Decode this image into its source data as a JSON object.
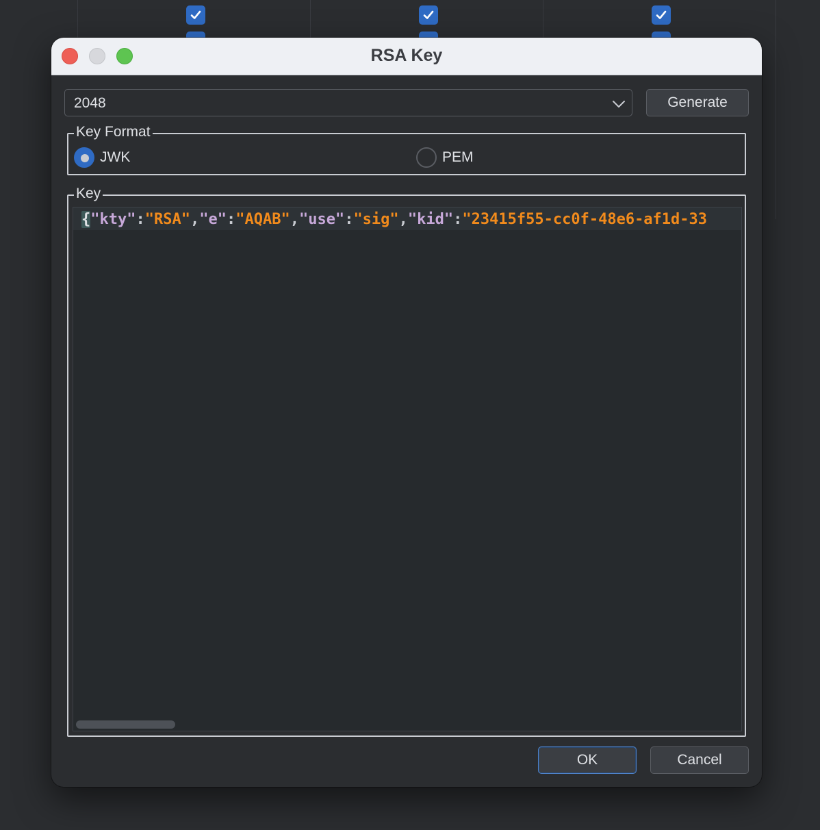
{
  "dialog": {
    "title": "RSA Key"
  },
  "key_size": {
    "selected": "2048"
  },
  "generate_label": "Generate",
  "key_format": {
    "legend": "Key Format",
    "options": [
      {
        "label": "JWK",
        "selected": true
      },
      {
        "label": "PEM",
        "selected": false
      }
    ]
  },
  "key": {
    "legend": "Key",
    "tokens": {
      "open_brace": "{",
      "q1": "\"kty\"",
      "c1": ":",
      "v1": "\"RSA\"",
      "s1": ",",
      "q2": "\"e\"",
      "c2": ":",
      "v2": "\"AQAB\"",
      "s2": ",",
      "q3": "\"use\"",
      "c3": ":",
      "v3": "\"sig\"",
      "s3": ",",
      "q4": "\"kid\"",
      "c4": ":",
      "v4": "\"23415f55-cc0f-48e6-af1d-33"
    }
  },
  "buttons": {
    "ok": "OK",
    "cancel": "Cancel"
  },
  "colors": {
    "accent": "#2f6bc4",
    "string": "#f28b1c",
    "json_key": "#c7a8d9"
  },
  "background_table": {
    "checkbox_states": [
      true,
      true,
      true
    ]
  }
}
